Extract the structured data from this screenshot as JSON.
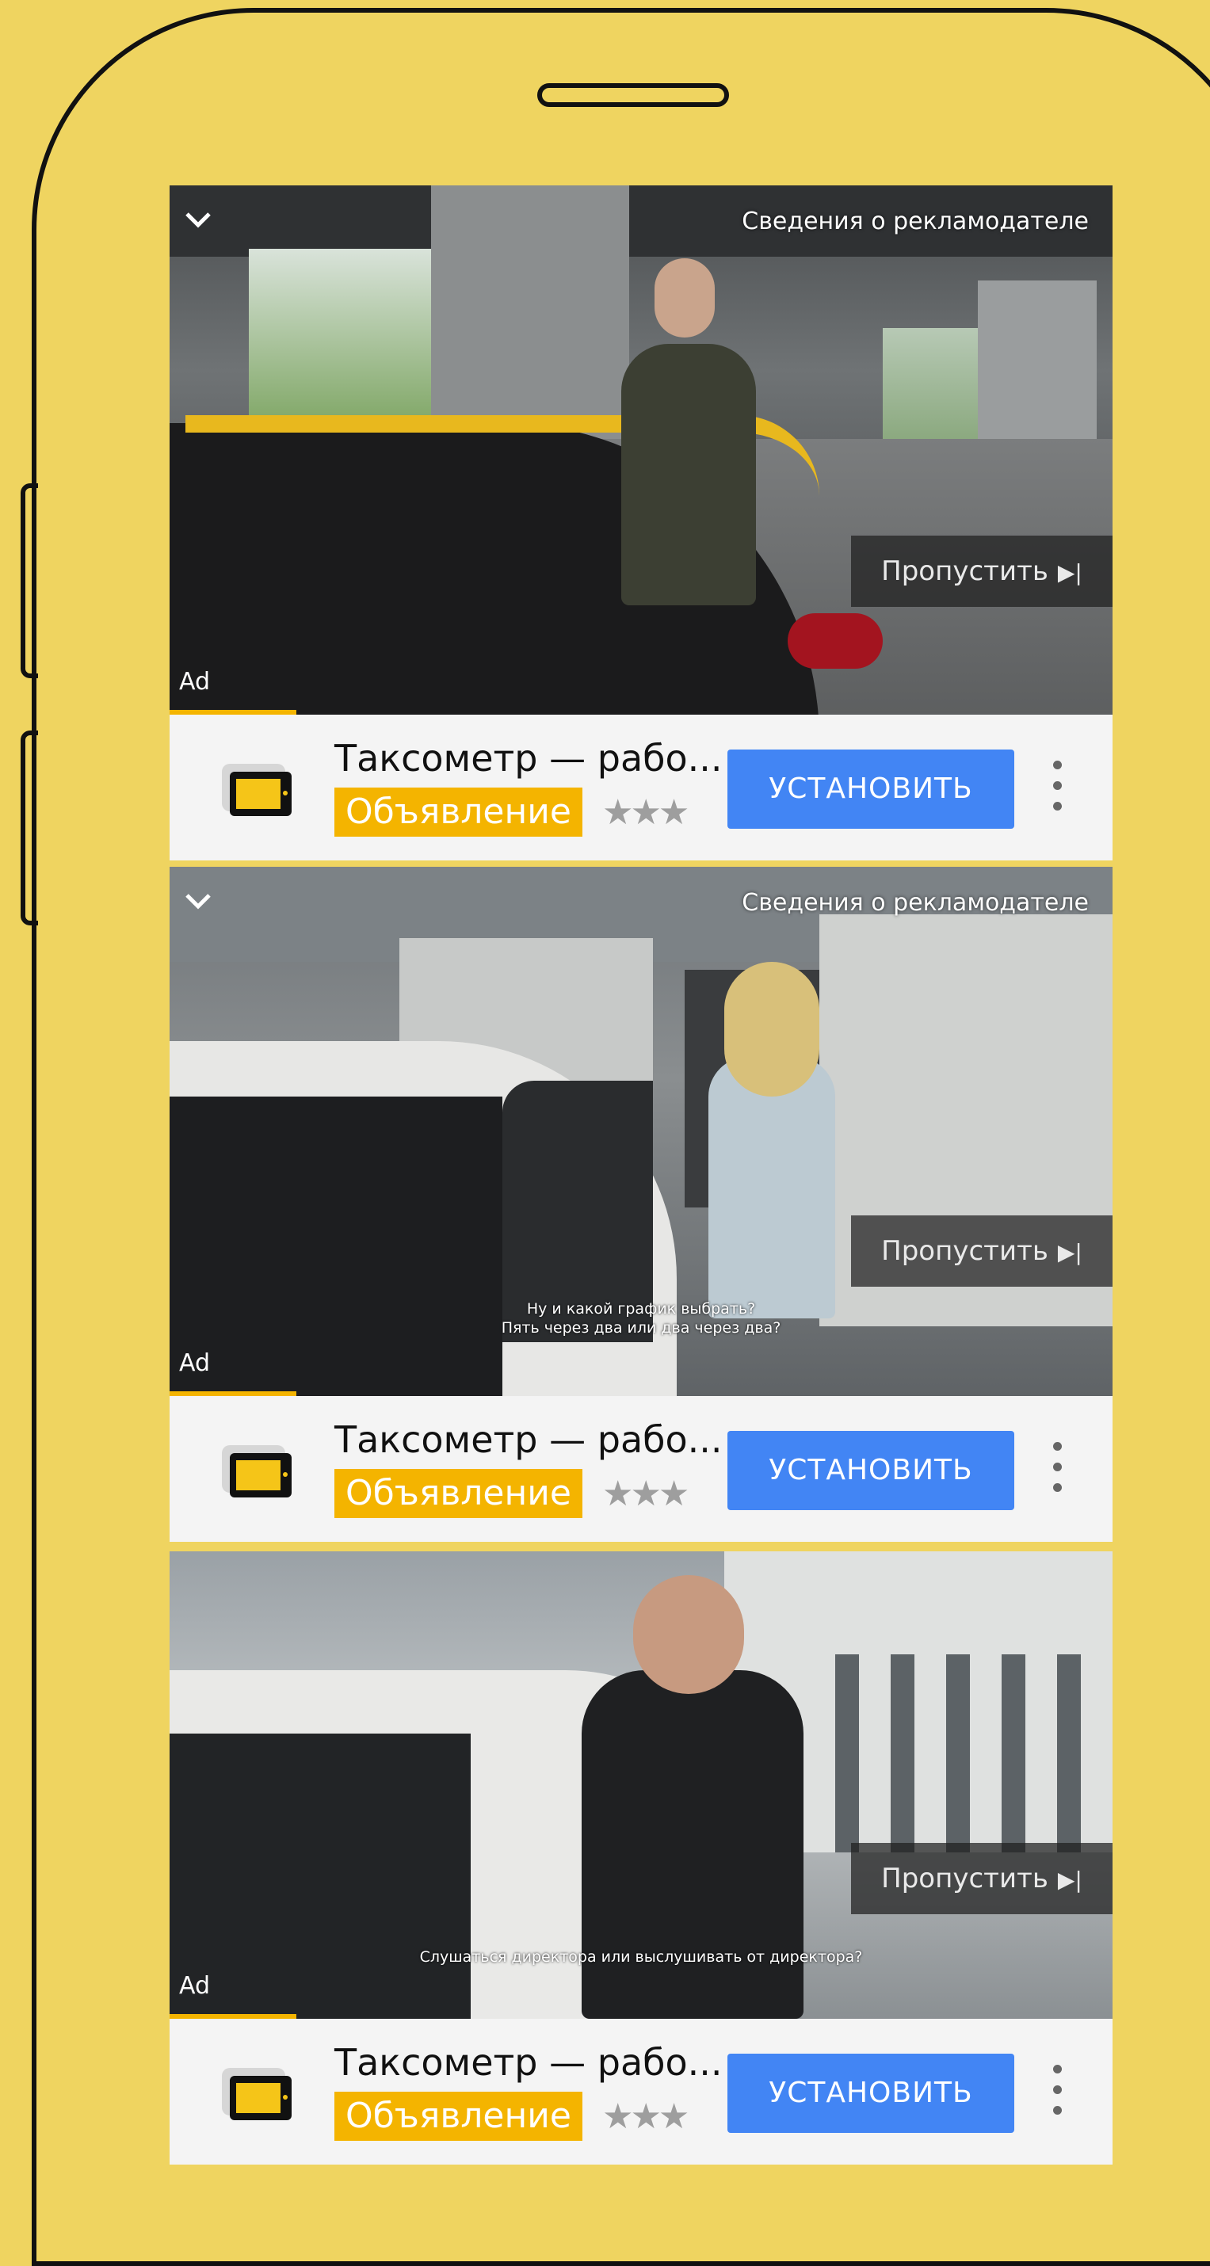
{
  "ads": [
    {
      "advertiser_info": "Сведения о рекламодателе",
      "skip_label": "Пропустить",
      "ad_label": "Ad",
      "subtitle_lines": [],
      "app_title": "Таксометр — рабо...",
      "ad_badge": "Объявление",
      "stars": "★★★",
      "install_label": "УСТАНОВИТЬ"
    },
    {
      "advertiser_info": "Сведения о рекламодателе",
      "skip_label": "Пропустить",
      "ad_label": "Ad",
      "subtitle_lines": [
        "Ну и какой график выбрать?",
        "Пять через два или два через два?"
      ],
      "app_title": "Таксометр — рабо...",
      "ad_badge": "Объявление",
      "stars": "★★★",
      "install_label": "УСТАНОВИТЬ"
    },
    {
      "advertiser_info": "",
      "skip_label": "Пропустить",
      "ad_label": "Ad",
      "subtitle_lines": [
        "Слушаться директора или выслушивать от директора?"
      ],
      "app_title": "Таксометр — рабо...",
      "ad_badge": "Объявление",
      "stars": "★★★",
      "install_label": "УСТАНОВИТЬ"
    }
  ],
  "colors": {
    "background": "#efd460",
    "install_button": "#4285f4",
    "badge": "#f4b400",
    "taxi_yellow": "#f5c518"
  }
}
